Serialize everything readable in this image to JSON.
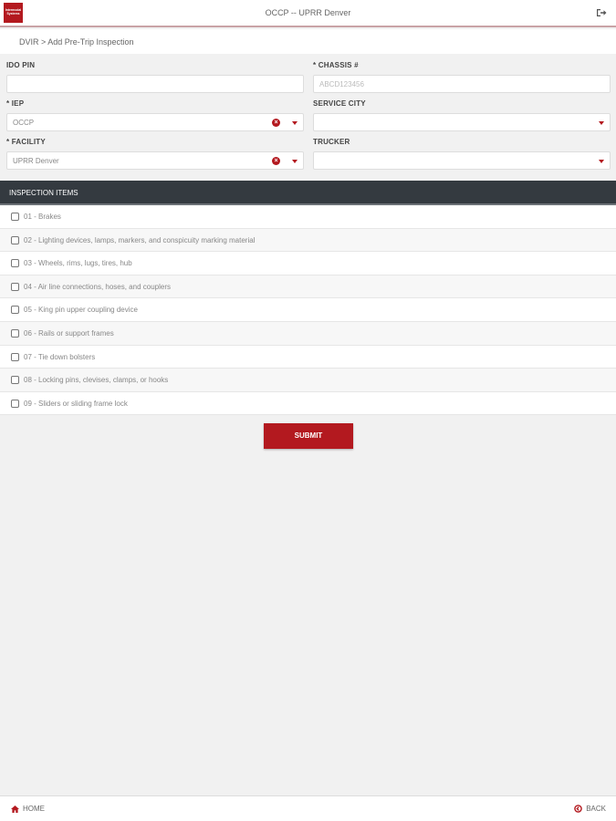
{
  "header": {
    "logo_text": "Intermodal Systems",
    "title": "OCCP -- UPRR Denver"
  },
  "breadcrumb": "DVIR > Add Pre-Trip Inspection",
  "form": {
    "ido_pin": {
      "label": "IDO PIN",
      "value": ""
    },
    "chassis": {
      "label": "* CHASSIS #",
      "placeholder": "ABCD123456"
    },
    "iep": {
      "label": "* IEP",
      "value": "OCCP"
    },
    "service_city": {
      "label": "SERVICE CITY",
      "value": ""
    },
    "facility": {
      "label": "* FACILITY",
      "value": "UPRR Denver"
    },
    "trucker": {
      "label": "TRUCKER",
      "value": ""
    }
  },
  "inspection": {
    "header": "INSPECTION ITEMS",
    "items": [
      "01 - Brakes",
      "02 - Lighting devices, lamps, markers, and conspicuity marking material",
      "03 - Wheels, rims, lugs, tires, hub",
      "04 - Air line connections, hoses, and couplers",
      "05 - King pin upper coupling device",
      "06 - Rails or support frames",
      "07 - Tie down bolsters",
      "08 - Locking pins, clevises, clamps, or hooks",
      "09 - Sliders or sliding frame lock"
    ]
  },
  "submit_label": "SUBMIT",
  "footer": {
    "home": "HOME",
    "back": "BACK"
  },
  "colors": {
    "brand": "#b3191f",
    "section_header": "#343a40"
  }
}
